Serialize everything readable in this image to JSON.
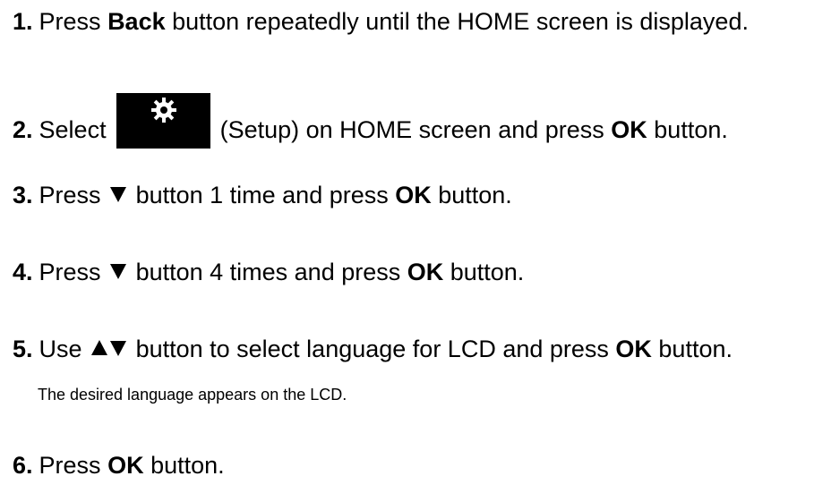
{
  "steps": [
    {
      "num": "1.",
      "p1": "Press ",
      "b1": "Back",
      "p2": " button repeatedly until the HOME screen is displayed."
    },
    {
      "num": "2.",
      "p1": "Select ",
      "icon": "gear-icon",
      "p2": " (Setup) on HOME screen and press ",
      "b1": "OK",
      "p3": " button."
    },
    {
      "num": "3.",
      "p1": "Press ",
      "icon": "down-triangle-icon",
      "p2": " button 1 time and press ",
      "b1": "OK",
      "p3": " button."
    },
    {
      "num": "4.",
      "p1": "Press ",
      "icon": "down-triangle-icon",
      "p2": " button 4 times and press ",
      "b1": "OK",
      "p3": " button."
    },
    {
      "num": "5.",
      "p1": "Use ",
      "icons": [
        "up-triangle-icon",
        "down-triangle-icon"
      ],
      "p2": " button to select language for LCD and press ",
      "b1": "OK",
      "p3": " button.",
      "note": "The desired language appears on the LCD."
    },
    {
      "num": "6.",
      "p1": "Press ",
      "b1": "OK",
      "p2": " button."
    }
  ]
}
